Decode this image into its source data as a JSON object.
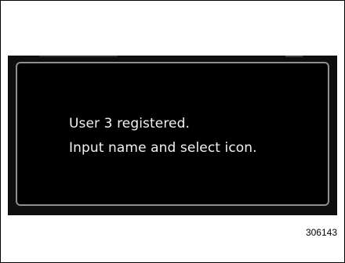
{
  "dialog": {
    "line1": "User 3 registered.",
    "line2": "Input name and select icon."
  },
  "figure_number": "306143",
  "colors": {
    "screen_background": "#0e0e0e",
    "dialog_border": "#8f8f8f",
    "text": "#f2f2f2"
  }
}
